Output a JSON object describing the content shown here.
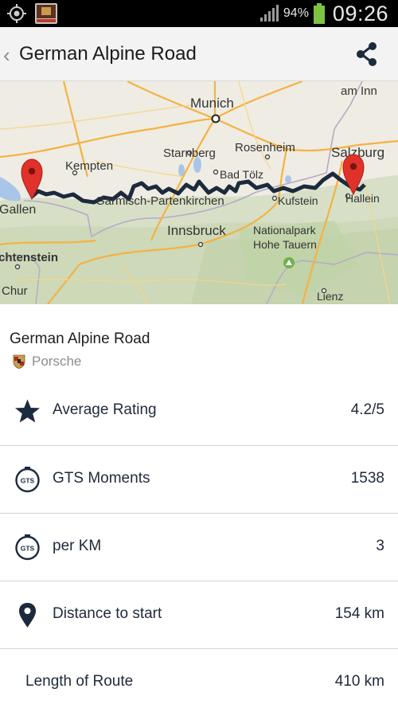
{
  "status_bar": {
    "battery_percent": "94%",
    "time": "09:26"
  },
  "header": {
    "title": "German Alpine Road"
  },
  "map": {
    "labels": {
      "munich": "Munich",
      "am_inn": "am Inn",
      "kempten": "Kempten",
      "starnberg": "Starnberg",
      "rosenheim": "Rosenheim",
      "salzburg": "Salzburg",
      "bad_tolz": "Bad Tölz",
      "gallen": "Gallen",
      "garmisch": "Garmisch-Partenkirchen",
      "kufstein": "Kufstein",
      "hallein": "Hallein",
      "innsbruck": "Innsbruck",
      "nationalpark": "Nationalpark",
      "hohe_tauern": "Hohe Tauern",
      "liechtenstein": "chtenstein",
      "chur": "Chur",
      "lienz": "Lienz"
    },
    "colors": {
      "route": "#1c2a3e",
      "marker": "#e0322b"
    }
  },
  "route": {
    "name": "German Alpine Road",
    "brand": "Porsche"
  },
  "stats": [
    {
      "icon": "star-icon",
      "label": "Average Rating",
      "value": "4.2/5"
    },
    {
      "icon": "gts-timer-icon",
      "label": "GTS Moments",
      "value": "1538"
    },
    {
      "icon": "gts-timer-icon",
      "label": "per KM",
      "value": "3"
    },
    {
      "icon": "location-pin-icon",
      "label": "Distance to start",
      "value": "154 km"
    },
    {
      "icon": "",
      "label": "Length of Route",
      "value": "410 km"
    }
  ]
}
